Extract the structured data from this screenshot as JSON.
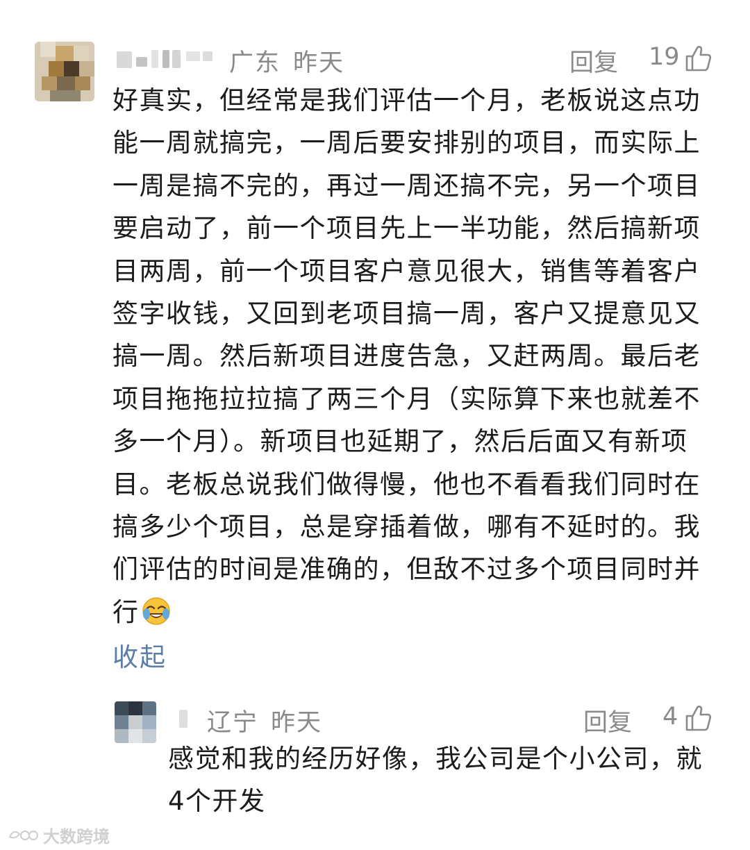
{
  "comment": {
    "location": "广东",
    "time": "昨天",
    "reply_label": "回复",
    "likes": "19",
    "text": "好真实，但经常是我们评估一个月，老板说这点功能一周就搞完，一周后要安排别的项目，而实际上一周是搞不完的，再过一周还搞不完，另一个项目要启动了，前一个项目先上一半功能，然后搞新项目两周，前一个项目客户意见很大，销售等着客户签字收钱，又回到老项目搞一周，客户又提意见又搞一周。然后新项目进度告急，又赶两周。最后老项目拖拖拉拉搞了两三个月（实际算下来也就差不多一个月）。新项目也延期了，然后后面又有新项目。老板总说我们做得慢，他也不看看我们同时在搞多少个项目，总是穿插着做，哪有不延时的。我们评估的时间是准确的，但敌不过多个项目同时并行",
    "emoji": "crying-laughing-emoji",
    "collapse_label": "收起"
  },
  "reply": {
    "location": "辽宁",
    "time": "昨天",
    "reply_label": "回复",
    "likes": "4",
    "text": "感觉和我的经历好像，我公司是个小公司，就4个开发"
  },
  "watermark": {
    "text": "大数跨境"
  },
  "colors": {
    "meta": "#8a8a8a",
    "text": "#1b1b1b",
    "link": "#5a7ea6"
  }
}
